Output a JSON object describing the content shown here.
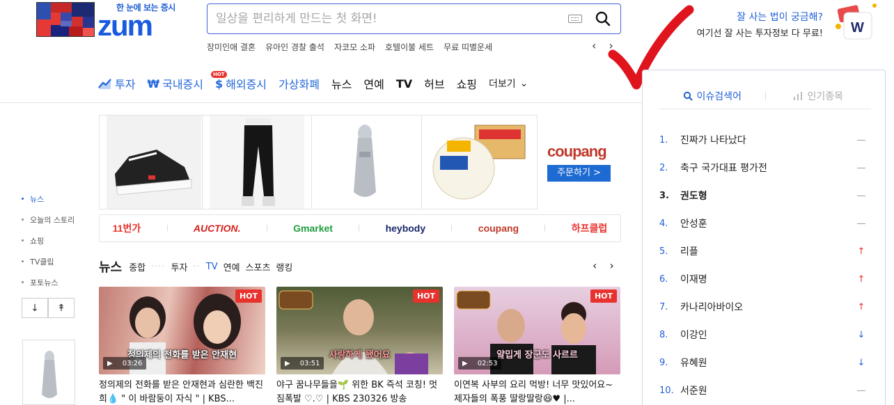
{
  "header": {
    "logo_tagline": "한 눈에 보는 증시",
    "logo_word": "zum",
    "search_placeholder": "일상을 편리하게 만드는 첫 화면!",
    "keywords": [
      "장미인애 결혼",
      "유아인 경찰 출석",
      "자코모 소파",
      "호텔이불 세트",
      "무료 띠별운세"
    ],
    "promo_line1": "잘 사는 법이 궁금해?",
    "promo_line2": "여기선 잘 사는 투자정보 다 무료!"
  },
  "nav": {
    "items": [
      {
        "label": "투자",
        "style": "blue"
      },
      {
        "label": "국내증시",
        "style": "blue"
      },
      {
        "label": "해외증시",
        "style": "blue"
      },
      {
        "label": "가상화폐",
        "style": "blue"
      },
      {
        "label": "뉴스",
        "style": "dark"
      },
      {
        "label": "연예",
        "style": "dark"
      },
      {
        "label": "TV",
        "style": "dark"
      },
      {
        "label": "허브",
        "style": "dark"
      },
      {
        "label": "쇼핑",
        "style": "dark"
      }
    ],
    "hot_badge": "HOT",
    "more_label": "더보기"
  },
  "ad": {
    "coupang_label": "coupang",
    "order_button": "주문하기 >",
    "shops": [
      "11번가",
      "AUCTION.",
      "Gmarket",
      "heybody",
      "coupang",
      "하프클럽"
    ]
  },
  "sidebar": {
    "items": [
      "뉴스",
      "오늘의 스토리",
      "쇼핑",
      "TV클립",
      "포토뉴스"
    ]
  },
  "news": {
    "title": "뉴스",
    "tabs": [
      "종합",
      "투자",
      "TV",
      "연예",
      "스포츠",
      "랭킹"
    ],
    "active_tab": "TV",
    "cards": [
      {
        "hot": "HOT",
        "duration": "03:26",
        "overlay": "정의제의 전화를 받은 안재현",
        "title": "정의제의 전화를 받은 안재현과 심란한 백진희💧 \" 이 바람둥이 자식 \" | KBS..."
      },
      {
        "hot": "HOT",
        "duration": "03:51",
        "overlay": "사랑하게 됐어요",
        "title": "야구 꿈나무들을🌱 위한 BK 즉석 코칭! 멋짐폭발 ♡.♡ | KBS 230326 방송"
      },
      {
        "hot": "HOT",
        "duration": "02:53",
        "overlay": "얄밉게 장군도 사르르",
        "title": "이연복 사부의 요리 먹방! 너무 맛있어요~ 제자들의 폭풍 딸랑딸랑😆♥ |..."
      }
    ]
  },
  "panel": {
    "tab_issue": "이슈검색어",
    "tab_stock": "인기종목",
    "ranks": [
      {
        "n": "1.",
        "t": "진짜가 나타났다",
        "status": "same"
      },
      {
        "n": "2.",
        "t": "축구 국가대표 평가전",
        "status": "same"
      },
      {
        "n": "3.",
        "t": "권도형",
        "status": "same"
      },
      {
        "n": "4.",
        "t": "안성훈",
        "status": "same"
      },
      {
        "n": "5.",
        "t": "리플",
        "status": "up"
      },
      {
        "n": "6.",
        "t": "이재명",
        "status": "up"
      },
      {
        "n": "7.",
        "t": "카나리아바이오",
        "status": "up"
      },
      {
        "n": "8.",
        "t": "이강인",
        "status": "down"
      },
      {
        "n": "9.",
        "t": "유혜원",
        "status": "down"
      },
      {
        "n": "10.",
        "t": "서준원",
        "status": "same"
      }
    ]
  },
  "colors": {
    "brand_blue": "#1f5fd6",
    "hot_red": "#e8322e",
    "check_red": "#e0141d"
  }
}
